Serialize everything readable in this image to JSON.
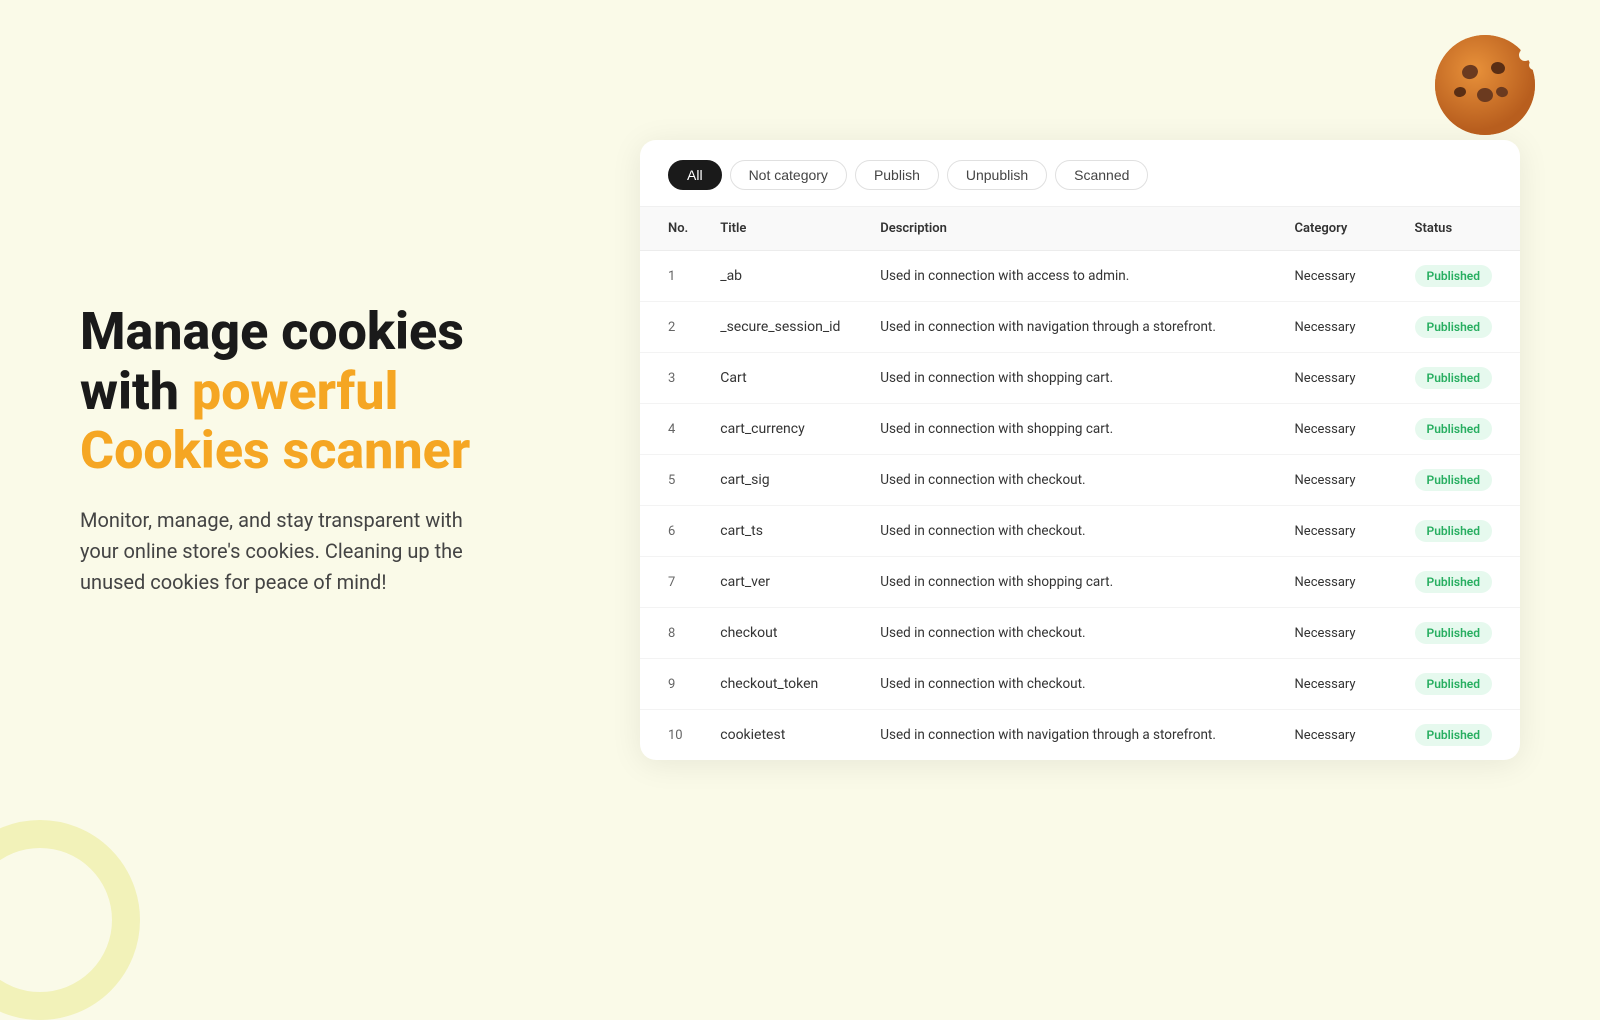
{
  "background_color": "#fafae8",
  "left": {
    "headline_part1": "Manage cookies",
    "headline_part2": "with ",
    "headline_highlight": "powerful",
    "headline_part3": "Cookies scanner",
    "subtext": "Monitor, manage, and stay transparent with your online store's cookies. Cleaning up the unused cookies for peace of mind!"
  },
  "filters": [
    {
      "label": "All",
      "active": true
    },
    {
      "label": "Not category",
      "active": false
    },
    {
      "label": "Publish",
      "active": false
    },
    {
      "label": "Unpublish",
      "active": false
    },
    {
      "label": "Scanned",
      "active": false
    }
  ],
  "table": {
    "columns": [
      "No.",
      "Title",
      "Description",
      "Category",
      "Status"
    ],
    "rows": [
      {
        "no": 1,
        "title": "_ab",
        "description": "Used in connection with access to admin.",
        "category": "Necessary",
        "status": "Published"
      },
      {
        "no": 2,
        "title": "_secure_session_id",
        "description": "Used in connection with navigation through a storefront.",
        "category": "Necessary",
        "status": "Published"
      },
      {
        "no": 3,
        "title": "Cart",
        "description": "Used in connection with shopping cart.",
        "category": "Necessary",
        "status": "Published"
      },
      {
        "no": 4,
        "title": "cart_currency",
        "description": "Used in connection with shopping cart.",
        "category": "Necessary",
        "status": "Published"
      },
      {
        "no": 5,
        "title": "cart_sig",
        "description": "Used in connection with checkout.",
        "category": "Necessary",
        "status": "Published"
      },
      {
        "no": 6,
        "title": "cart_ts",
        "description": "Used in connection with checkout.",
        "category": "Necessary",
        "status": "Published"
      },
      {
        "no": 7,
        "title": "cart_ver",
        "description": "Used in connection with shopping cart.",
        "category": "Necessary",
        "status": "Published"
      },
      {
        "no": 8,
        "title": "checkout",
        "description": "Used in connection with checkout.",
        "category": "Necessary",
        "status": "Published"
      },
      {
        "no": 9,
        "title": "checkout_token",
        "description": "Used in connection with checkout.",
        "category": "Necessary",
        "status": "Published"
      },
      {
        "no": 10,
        "title": "cookietest",
        "description": "Used in connection with navigation through a storefront.",
        "category": "Necessary",
        "status": "Published"
      }
    ]
  }
}
